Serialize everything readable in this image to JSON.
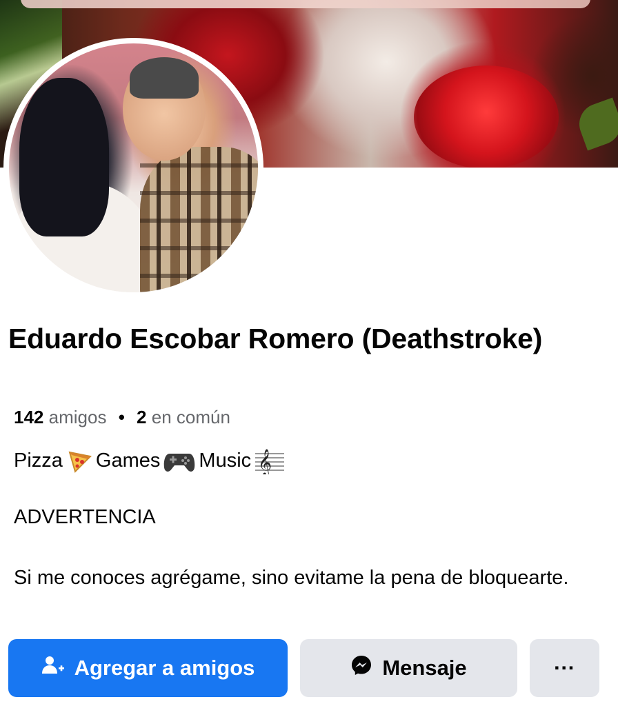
{
  "profile": {
    "name": "Eduardo Escobar Romero (Deathstroke)",
    "friends_count": "142",
    "friends_label": "amigos",
    "mutual_count": "2",
    "mutual_label": "en común"
  },
  "bio": {
    "interests": [
      {
        "label": "Pizza",
        "icon": "pizza-icon"
      },
      {
        "label": "Games",
        "icon": "game-controller-icon"
      },
      {
        "label": "Music",
        "icon": "music-score-icon"
      }
    ],
    "heading": "ADVERTENCIA",
    "text": "Si me conoces agrégame, sino evitame la pena de bloquearte."
  },
  "actions": {
    "add_friend_label": "Agregar a amigos",
    "message_label": "Mensaje",
    "more_label": "···"
  },
  "colors": {
    "primary_blue": "#1877f2",
    "secondary_gray": "#e4e6eb",
    "text_secondary": "#65676b"
  }
}
